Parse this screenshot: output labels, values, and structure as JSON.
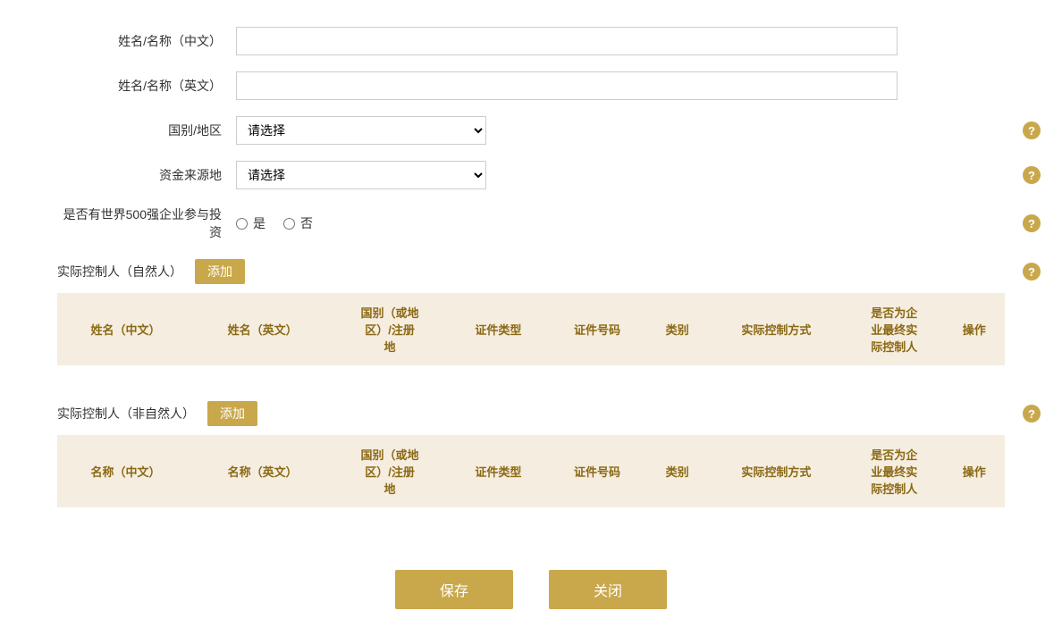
{
  "form": {
    "name_cn_label": "姓名/名称（中文）",
    "name_en_label": "姓名/名称（英文）",
    "country_label": "国别/地区",
    "country_placeholder": "请选择",
    "funds_label": "资金来源地",
    "funds_placeholder": "请选择",
    "fortune500_label": "是否有世界500强企业参与投资",
    "fortune500_yes": "是",
    "fortune500_no": "否",
    "help_icon": "?"
  },
  "section1": {
    "title": "实际控制人（自然人）",
    "add_btn": "添加",
    "columns": [
      "姓名（中文）",
      "姓名（英文）",
      "国别（或地区）/注册地",
      "证件类型",
      "证件号码",
      "类别",
      "实际控制方式",
      "是否为企业最终实际控制人",
      "操作"
    ]
  },
  "section2": {
    "title": "实际控制人（非自然人）",
    "add_btn": "添加",
    "columns": [
      "名称（中文）",
      "名称（英文）",
      "国别（或地区）/注册地",
      "证件类型",
      "证件号码",
      "类别",
      "实际控制方式",
      "是否为企业最终实际控制人",
      "操作"
    ]
  },
  "buttons": {
    "save": "保存",
    "close": "关闭"
  }
}
